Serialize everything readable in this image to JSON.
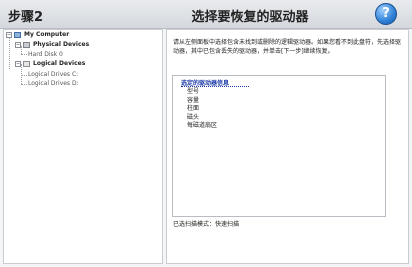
{
  "header": {
    "step": "步骤2",
    "title": "选择要恢复的驱动器",
    "help_glyph": "?"
  },
  "tree": {
    "root": "My Computer",
    "physical": "Physical Devices",
    "hard_disk": "Hard Disk 0",
    "logical": "Logical Devices",
    "drive_c": "Logical Drives C:",
    "drive_d": "Logical Drives D:"
  },
  "panel": {
    "instructions": "请从左侧面板中选择包含未找到或删除的逻辑驱动器。如果您看不到此盘符，先选择驱动器，其中已包含丢失的驱动器，并单击[下一步]继续恢复。",
    "info_title": "选定的驱动器信息",
    "info_fields": [
      "型号",
      "容量",
      "柱面",
      "磁头",
      "每磁道扇区"
    ],
    "scan_mode": "已选扫描模式：快速扫描"
  },
  "colors": {
    "accent_blue": "#1b3aa8",
    "help_blue": "#2e7fd6"
  }
}
